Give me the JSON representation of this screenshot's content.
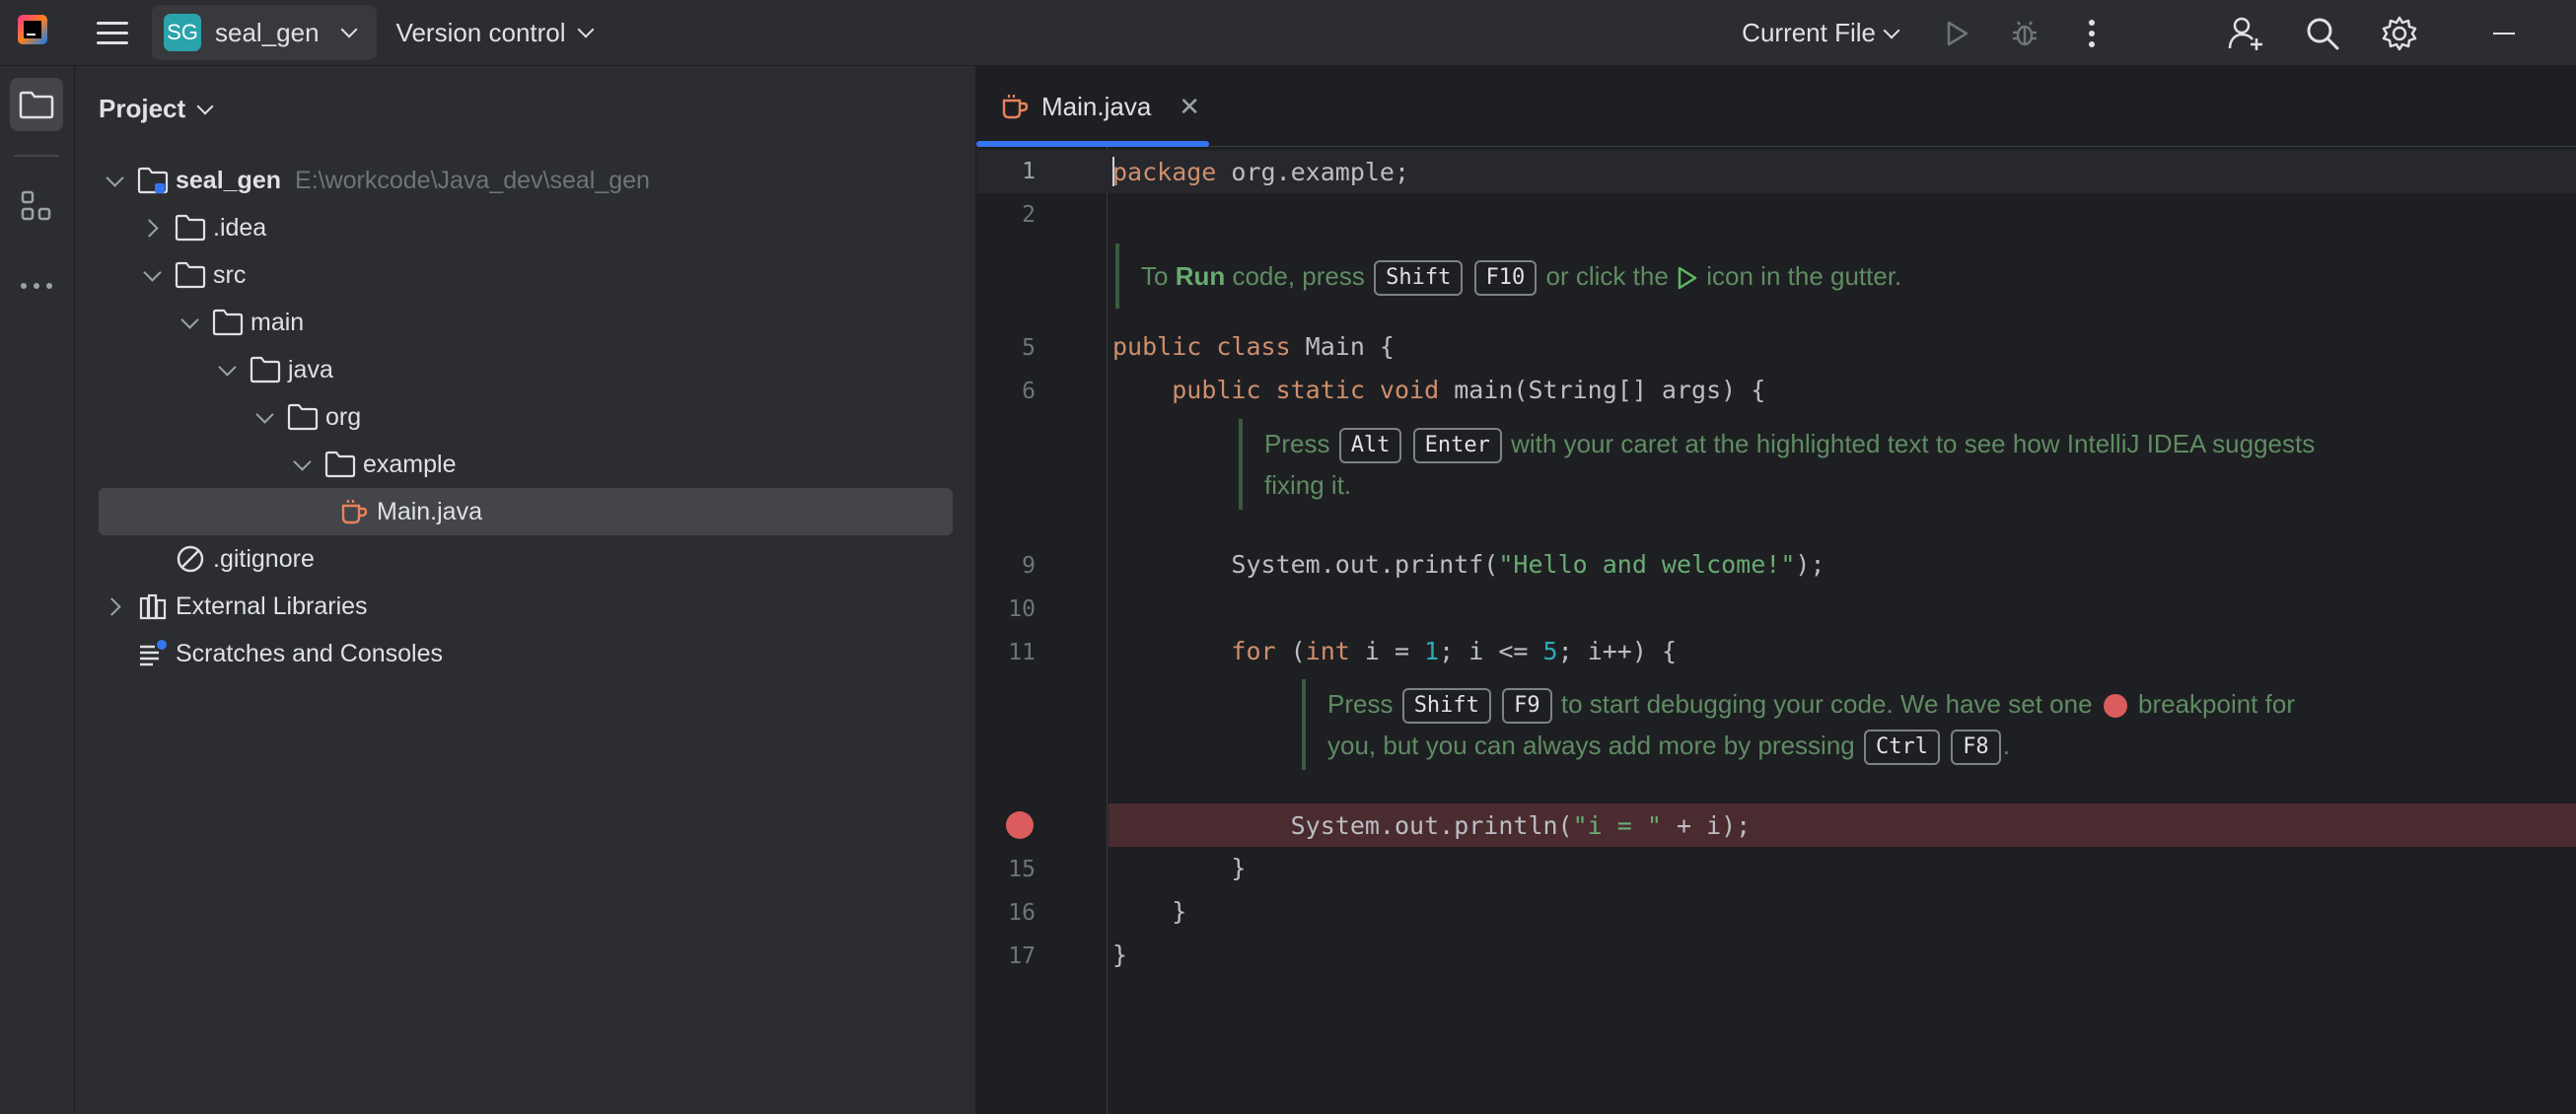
{
  "titlebar": {
    "project_initials": "SG",
    "project_name": "seal_gen",
    "vcs_label": "Version control",
    "run_config": "Current File"
  },
  "project_panel": {
    "title": "Project",
    "tree": [
      {
        "label": "seal_gen",
        "hint": "E:\\workcode\\Java_dev\\seal_gen"
      },
      {
        "label": ".idea"
      },
      {
        "label": "src"
      },
      {
        "label": "main"
      },
      {
        "label": "java"
      },
      {
        "label": "org"
      },
      {
        "label": "example"
      },
      {
        "label": "Main.java"
      },
      {
        "label": ".gitignore"
      },
      {
        "label": "External Libraries"
      },
      {
        "label": "Scratches and Consoles"
      }
    ]
  },
  "editor": {
    "tab_label": "Main.java",
    "line_numbers": [
      "1",
      "2",
      "5",
      "6",
      "9",
      "10",
      "11",
      "15",
      "16",
      "17"
    ],
    "code": {
      "l1_kw": "package",
      "l1_rest": " org.example;",
      "l5_kw": "public class",
      "l5_rest": " Main {",
      "l6_indent": "    ",
      "l6_kw": "public static void",
      "l6_rest": " main(String[] args) {",
      "l9_indent": "        ",
      "l9_pre": "System.out.printf(",
      "l9_str": "\"Hello and welcome!\"",
      "l9_post": ");",
      "l11_indent": "        ",
      "l11_kw1": "for",
      "l11_p1": " (",
      "l11_kw2": "int",
      "l11_p2": " i = ",
      "l11_n1": "1",
      "l11_p3": "; i <= ",
      "l11_n2": "5",
      "l11_p4": "; i++) {",
      "l14_indent": "            ",
      "l14_pre": "System.out.println(",
      "l14_str": "\"i = \"",
      "l14_post": " + i);",
      "l15": "        }",
      "l16": "    }",
      "l17": "}"
    },
    "hints": {
      "h1_a": "To ",
      "h1_b": "Run",
      "h1_c": " code, press ",
      "h1_k1": "Shift",
      "h1_k2": "F10",
      "h1_d": " or click the ",
      "h1_e": " icon in the gutter.",
      "h2_a": "Press ",
      "h2_k1": "Alt",
      "h2_k2": "Enter",
      "h2_b": " with your caret at the highlighted text to see how IntelliJ IDEA suggests",
      "h2_c": "fixing it.",
      "h3_a": "Press ",
      "h3_k1": "Shift",
      "h3_k2": "F9",
      "h3_b": " to start debugging your code. We have set one ",
      "h3_c": " breakpoint for",
      "h3_d": "you, but you can always add more by pressing ",
      "h3_k3": "Ctrl",
      "h3_k4": "F8",
      "h3_e": "."
    }
  },
  "colors": {
    "accent": "#3574f0",
    "keyword": "#cf8e6d",
    "string": "#6aab73",
    "number": "#2aacb8",
    "breakpoint": "#db5c5c"
  }
}
